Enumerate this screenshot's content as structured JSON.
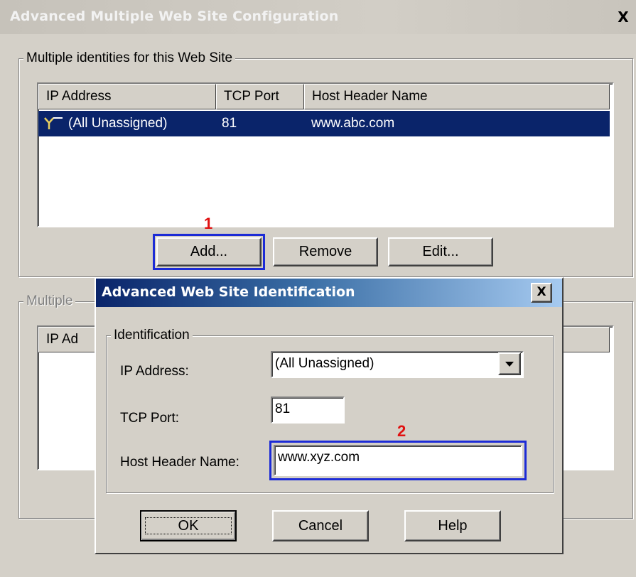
{
  "window": {
    "title": "Advanced Multiple Web Site Configuration",
    "close_glyph": "X"
  },
  "identities_group": {
    "label": "Multiple identities for this Web Site",
    "columns": [
      "IP Address",
      "TCP Port",
      "Host Header Name"
    ],
    "rows": [
      {
        "ip": "(All Unassigned)",
        "port": "81",
        "host": "www.abc.com",
        "icon": "network-connection-icon",
        "selected": true
      }
    ],
    "buttons": {
      "add": "Add...",
      "remove": "Remove",
      "edit": "Edit..."
    }
  },
  "ssl_group": {
    "label_partial": "Multiple",
    "column_partial": "IP Ad"
  },
  "markers": {
    "one": "1",
    "two": "2"
  },
  "dialog": {
    "title": "Advanced Web Site Identification",
    "close_glyph": "X",
    "group_label": "Identification",
    "ip_label": "IP Address:",
    "ip_value": "(All Unassigned)",
    "port_label": "TCP Port:",
    "port_value": "81",
    "host_label": "Host Header Name:",
    "host_value": "www.xyz.com",
    "ok": "OK",
    "cancel": "Cancel",
    "help": "Help"
  },
  "colors": {
    "selection": "#0a246a",
    "highlight_box": "#1c2bd6",
    "marker": "#e01010"
  }
}
